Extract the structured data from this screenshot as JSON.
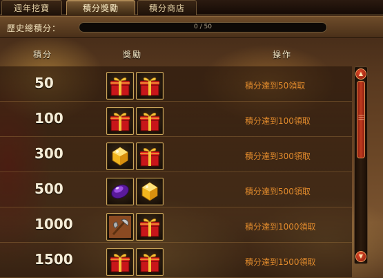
{
  "tabs": [
    {
      "label": "週年挖寶",
      "active": false
    },
    {
      "label": "積分獎勵",
      "active": true
    },
    {
      "label": "積分商店",
      "active": false
    }
  ],
  "history": {
    "label": "歷史總積分：",
    "current": 0,
    "max": 50,
    "progress_text": "0 / 50"
  },
  "columns": {
    "points": "積分",
    "reward": "獎勵",
    "action": "操作"
  },
  "rows": [
    {
      "points": "50",
      "rewards": [
        "gift-box-icon",
        "gift-box-icon"
      ],
      "action": "積分達到50領取"
    },
    {
      "points": "100",
      "rewards": [
        "gift-box-icon",
        "gift-box-icon"
      ],
      "action": "積分達到100領取"
    },
    {
      "points": "300",
      "rewards": [
        "gold-crystal-icon",
        "gift-box-icon"
      ],
      "action": "積分達到300領取"
    },
    {
      "points": "500",
      "rewards": [
        "purple-gem-icon",
        "gold-crystal-icon"
      ],
      "action": "積分達到500領取"
    },
    {
      "points": "1000",
      "rewards": [
        "axe-weapon-icon",
        "gift-box-icon"
      ],
      "action": "積分達到1000領取"
    },
    {
      "points": "1500",
      "rewards": [
        "gift-box-icon",
        "gift-box-icon"
      ],
      "action": "積分達到1500領取"
    }
  ],
  "colors": {
    "claim_text": "#e08a2c",
    "gold_border": "#c9a45a"
  }
}
